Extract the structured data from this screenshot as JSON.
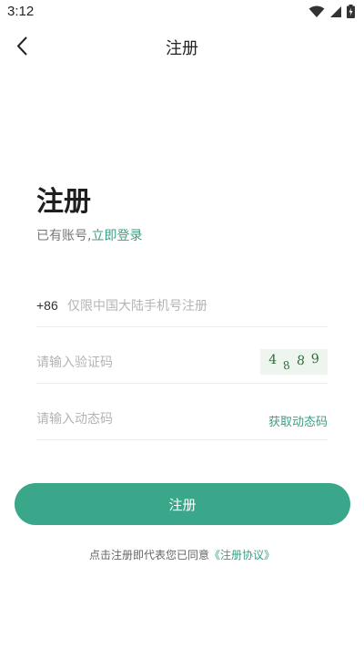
{
  "status_bar": {
    "time": "3:12",
    "icons": [
      "wifi-icon",
      "cellular-signal-icon",
      "battery-charging-icon"
    ]
  },
  "nav": {
    "back_icon": "chevron-left-icon",
    "title": "注册"
  },
  "heading": {
    "title": "注册",
    "login_prompt": "已有账号,",
    "login_link": "立即登录"
  },
  "form": {
    "phone": {
      "country_code": "+86",
      "placeholder": "仅限中国大陆手机号注册",
      "value": ""
    },
    "captcha": {
      "placeholder": "请输入验证码",
      "value": "",
      "image_text": [
        "4",
        "8",
        "8",
        "9"
      ]
    },
    "sms_code": {
      "placeholder": "请输入动态码",
      "value": "",
      "get_code_label": "获取动态码"
    },
    "submit_label": "注册"
  },
  "agreement": {
    "prefix": "点击注册即代表您已同意",
    "link": "《注册协议》"
  },
  "colors": {
    "accent": "#3aa68a",
    "link": "#3a9e84",
    "captcha_bg": "#eef5ee"
  }
}
